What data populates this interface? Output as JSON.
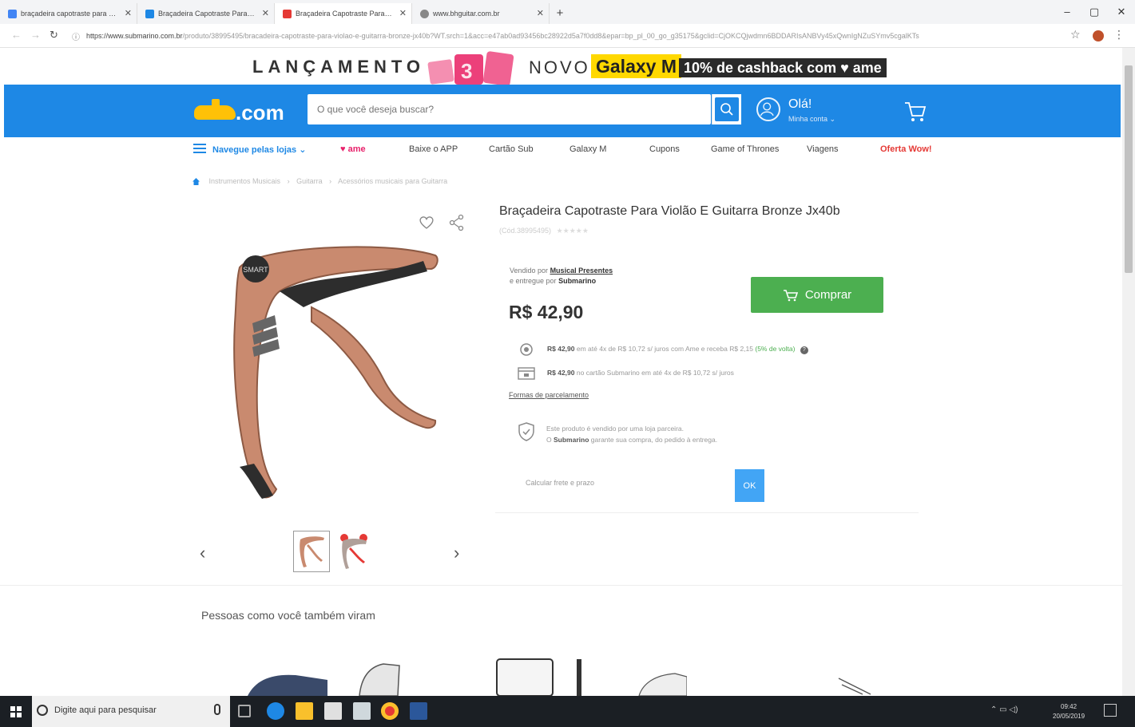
{
  "browser": {
    "tabs": [
      {
        "title": "braçadeira capotraste para violã",
        "favicon_color": "#4285f4",
        "active": false
      },
      {
        "title": "Braçadeira Capotraste Para Vio…",
        "favicon_color": "#1e88e5",
        "active": false
      },
      {
        "title": "Braçadeira Capotraste Para Viol",
        "favicon_color": "#e53935",
        "active": true
      },
      {
        "title": "www.bhguitar.com.br",
        "favicon_color": "#888888",
        "active": false
      }
    ],
    "new_tab": "+",
    "window_controls": {
      "minimize": "–",
      "maximize": "▢",
      "close": "✕"
    },
    "url_host": "https://www.submarino.com.br",
    "url_path": "/produto/38995495/bracadeira-capotraste-para-violao-e-guitarra-bronze-jx40b?WT.srch=1&acc=e47ab0ad93456bc28922d5a7f0dd8&epar=bp_pl_00_go_g35175&gclid=CjOKCQjwdmn6BDDARIsANBVy45xQwnIgNZuSYmv5cgalKTs"
  },
  "promo": {
    "lancamento": "LANÇAMENTO",
    "novo": "NOVO",
    "galaxy": "Galaxy M",
    "cashback": "10% de cashback com ♥ ame"
  },
  "header": {
    "logo_text": ".com",
    "search_placeholder": "O que você deseja buscar?",
    "greeting": "Olá!",
    "account_label": "Minha conta ⌄"
  },
  "nav": {
    "browse_label": "Navegue pelas lojas ⌄",
    "ame_label": "♥ ame",
    "items": [
      "Baixe o APP",
      "Cartão Sub",
      "Galaxy M",
      "Cupons",
      "Game of Thrones",
      "Viagens"
    ],
    "oferta": "Oferta Wow!"
  },
  "breadcrumb": [
    "Instrumentos Musicais",
    "Guitarra",
    "Acessórios musicais para Guitarra"
  ],
  "product": {
    "title": "Braçadeira Capotraste Para Violão E Guitarra Bronze Jx40b",
    "code": "(Cód.38995495)",
    "rating_stars": "★★★★★",
    "sold_by_prefix": "Vendido por",
    "seller_name": "Musical Presentes",
    "delivered_by_prefix": "e entregue por",
    "delivered_by": "Submarino",
    "buy_label": "Comprar",
    "price": "R$ 42,90",
    "ame_offer_price": "R$ 42,90",
    "ame_offer_text": "em até 4x de R$ 10,72 s/ juros com Ame e receba R$ 2,15",
    "ame_cashback": "(5% de volta)",
    "card_offer_price": "R$ 42,90",
    "card_offer_text": "no cartão Submarino em até 4x de R$ 10,72 s/ juros",
    "installments_link": "Formas de parcelamento",
    "partner_line1": "Este produto é vendido por uma loja parceira.",
    "partner_line2_prefix": "O",
    "partner_brand": "Submarino",
    "partner_line2_suffix": "garante sua compra, do pedido à entrega.",
    "freight_placeholder": "Calcular frete e prazo",
    "ok_label": "OK",
    "thumb_prev": "‹",
    "thumb_next": "›",
    "image_brand": "SMART"
  },
  "related": {
    "title": "Pessoas como você também viram"
  },
  "taskbar": {
    "search_placeholder": "Digite aqui para pesquisar",
    "tray": "⌃ ▭ ◁)",
    "time": "09:42",
    "date": "20/05/2019"
  },
  "colors": {
    "brand_blue": "#1e88e5",
    "buy_green": "#4caf50",
    "ame_pink": "#e8216b",
    "capo_bronze": "#c98a6f"
  }
}
